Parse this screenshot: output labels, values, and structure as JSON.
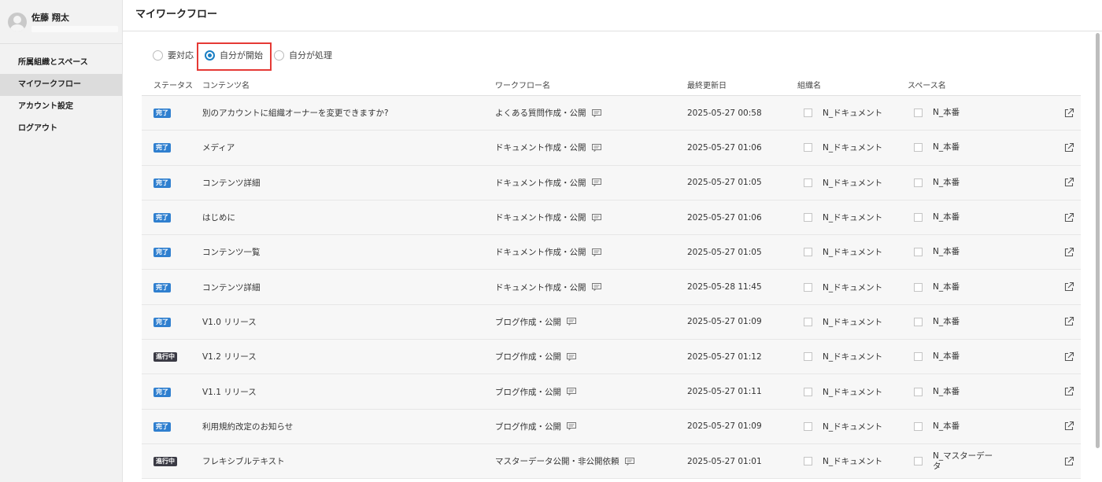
{
  "user": {
    "name": "佐藤 翔太"
  },
  "sidebar": {
    "items": [
      {
        "label": "所属組織とスペース",
        "active": false
      },
      {
        "label": "マイワークフロー",
        "active": true
      },
      {
        "label": "アカウント設定",
        "active": false
      },
      {
        "label": "ログアウト",
        "active": false
      }
    ]
  },
  "header": {
    "title": "マイワークフロー"
  },
  "filters": {
    "options": [
      {
        "label": "要対応",
        "checked": false
      },
      {
        "label": "自分が開始",
        "checked": true
      },
      {
        "label": "自分が処理",
        "checked": false
      }
    ]
  },
  "table": {
    "columns": {
      "status": "ステータス",
      "content": "コンテンツ名",
      "workflow": "ワークフロー名",
      "updated": "最終更新日",
      "org": "組織名",
      "space": "スペース名"
    },
    "rows": [
      {
        "status": "完了",
        "status_type": "done",
        "content": "別のアカウントに組織オーナーを変更できますか?",
        "workflow": "よくある質問作成・公開",
        "updated": "2025-05-27 00:58",
        "org": "N_ドキュメント",
        "space": "N_本番"
      },
      {
        "status": "完了",
        "status_type": "done",
        "content": "メディア",
        "workflow": "ドキュメント作成・公開",
        "updated": "2025-05-27 01:06",
        "org": "N_ドキュメント",
        "space": "N_本番"
      },
      {
        "status": "完了",
        "status_type": "done",
        "content": "コンテンツ詳細",
        "workflow": "ドキュメント作成・公開",
        "updated": "2025-05-27 01:05",
        "org": "N_ドキュメント",
        "space": "N_本番"
      },
      {
        "status": "完了",
        "status_type": "done",
        "content": "はじめに",
        "workflow": "ドキュメント作成・公開",
        "updated": "2025-05-27 01:06",
        "org": "N_ドキュメント",
        "space": "N_本番"
      },
      {
        "status": "完了",
        "status_type": "done",
        "content": "コンテンツ一覧",
        "workflow": "ドキュメント作成・公開",
        "updated": "2025-05-27 01:05",
        "org": "N_ドキュメント",
        "space": "N_本番"
      },
      {
        "status": "完了",
        "status_type": "done",
        "content": "コンテンツ詳細",
        "workflow": "ドキュメント作成・公開",
        "updated": "2025-05-28 11:45",
        "org": "N_ドキュメント",
        "space": "N_本番"
      },
      {
        "status": "完了",
        "status_type": "done",
        "content": "V1.0 リリース",
        "workflow": "ブログ作成・公開",
        "updated": "2025-05-27 01:09",
        "org": "N_ドキュメント",
        "space": "N_本番"
      },
      {
        "status": "進行中",
        "status_type": "progress",
        "content": "V1.2 リリース",
        "workflow": "ブログ作成・公開",
        "updated": "2025-05-27 01:12",
        "org": "N_ドキュメント",
        "space": "N_本番"
      },
      {
        "status": "完了",
        "status_type": "done",
        "content": "V1.1 リリース",
        "workflow": "ブログ作成・公開",
        "updated": "2025-05-27 01:11",
        "org": "N_ドキュメント",
        "space": "N_本番"
      },
      {
        "status": "完了",
        "status_type": "done",
        "content": "利用規約改定のお知らせ",
        "workflow": "ブログ作成・公開",
        "updated": "2025-05-27 01:09",
        "org": "N_ドキュメント",
        "space": "N_本番"
      },
      {
        "status": "進行中",
        "status_type": "progress",
        "content": "フレキシブルテキスト",
        "workflow": "マスターデータ公開・非公開依頼",
        "updated": "2025-05-27 01:01",
        "org": "N_ドキュメント",
        "space": "N_マスターデータ"
      }
    ]
  },
  "icons": {
    "comment": "comment-icon",
    "external_link": "external-link-icon",
    "avatar": "avatar-icon"
  },
  "colors": {
    "done_badge": "#2f7fcf",
    "progress_badge": "#3a3a44",
    "radio_accent": "#1a7fc4",
    "highlight": "#e53935"
  }
}
